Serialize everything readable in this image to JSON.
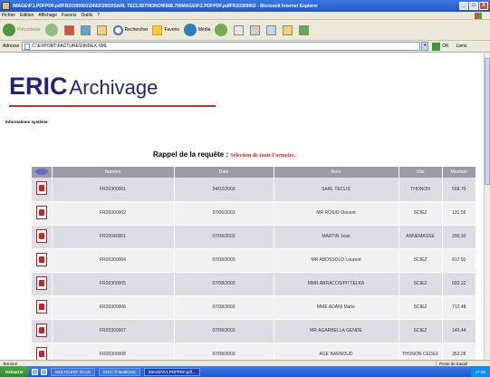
{
  "window": {
    "title": "IMAGE\\P.1.PDFPDF.pdfFR20300001\\24\\02\\2003\\SARL TECLIS\\THONON\\568.70\\IMAGE\\P.2.PDFPDF.pdfFR20300002 - Microsoft Internet Explorer",
    "min": "_",
    "max": "□",
    "close": "X"
  },
  "menu": [
    "Fichier",
    "Edition",
    "Affichage",
    "Favoris",
    "Outils",
    "?"
  ],
  "toolbar": {
    "back": "Précédente",
    "search": "Rechercher",
    "favorites": "Favoris",
    "media": "Média"
  },
  "address": {
    "label": "Adresse",
    "value": "C:\\EXPORT\\FACTURES\\INDEX.XML",
    "go": "OK",
    "links": "Liens"
  },
  "page": {
    "logo_bold": "ERIC",
    "logo_light": "Archivage",
    "sysinfo": "Informations système",
    "request_label": "Rappel de la requête :",
    "request_value": "Sélection de toute l'armoire."
  },
  "table": {
    "headers": [
      "Numéro",
      "Date",
      "Nom",
      "Ville",
      "Montant"
    ],
    "rows": [
      {
        "numero": "FR20300001",
        "date": "24/02/2003",
        "nom": "SARL TECLIS",
        "ville": "THONON",
        "montant": "568.70"
      },
      {
        "numero": "FR20300002",
        "date": "27/06/2003",
        "nom": "MR ROSIO Vincent",
        "ville": "SCIEZ",
        "montant": "131.55"
      },
      {
        "numero": "FR20040001",
        "date": "07/08/2003",
        "nom": "MARTIN Jean",
        "ville": "ANNEMASSE",
        "montant": "290.30"
      },
      {
        "numero": "FR20300004",
        "date": "07/08/2003",
        "nom": "MR ABOSSOLO Laurent",
        "ville": "SCIEZ",
        "montant": "617.91"
      },
      {
        "numero": "FR20300005",
        "date": "07/08/2003",
        "nom": "MMR ABRACOS/PITTELKA",
        "ville": "SCIEZ",
        "montant": "692.22"
      },
      {
        "numero": "FR20300006",
        "date": "07/08/2003",
        "nom": "MME ADANI Marie",
        "ville": "SCIEZ",
        "montant": "712.48"
      },
      {
        "numero": "FR20300007",
        "date": "07/08/2003",
        "nom": "MR AGARBELLA GENDE",
        "ville": "SCIEZ",
        "montant": "149.44"
      },
      {
        "numero": "FR20300008",
        "date": "07/08/2003",
        "nom": "AGE BARNOUD",
        "ville": "THONON CEDEX",
        "montant": "352.28"
      }
    ]
  },
  "status": {
    "left": "Terminé",
    "zone": "Poste de travail"
  },
  "taskbar": {
    "start": "Démarrer",
    "tasks": [
      "MULTIGEST SCAN",
      "ERIC © MultiGest",
      "IMAGE\\P.1.PDFPDF.pdf..."
    ],
    "clock": "17:36"
  }
}
